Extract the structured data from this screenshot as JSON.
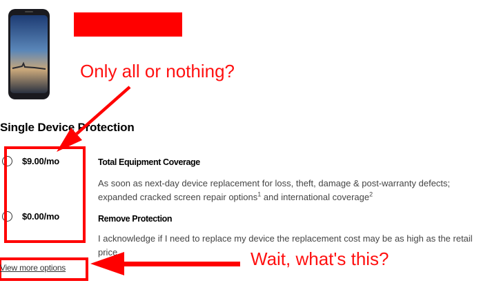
{
  "annotations": {
    "top_note": "Only all or nothing?",
    "bottom_note": "Wait, what's this?"
  },
  "section": {
    "title": "Single Device Protection"
  },
  "options": [
    {
      "price": "$9.00/mo",
      "title": "Total Equipment Coverage",
      "desc_part1": "As soon as next-day device replacement for loss, theft, damage & post-warranty defects; expanded cracked screen repair options",
      "footnote1": "1",
      "desc_part2": " and international coverage",
      "footnote2": "2",
      "selected": false
    },
    {
      "price": "$0.00/mo",
      "title": "Remove Protection",
      "description": "I acknowledge if I need to replace my device the replacement cost may be as high as the retail price.",
      "selected": false
    }
  ],
  "links": {
    "view_more": "View more options"
  },
  "colors": {
    "annotation_red": "#ff0000",
    "redaction": "#ff0000"
  },
  "icons": {
    "device": "phone-image",
    "radio": "radio-button"
  }
}
